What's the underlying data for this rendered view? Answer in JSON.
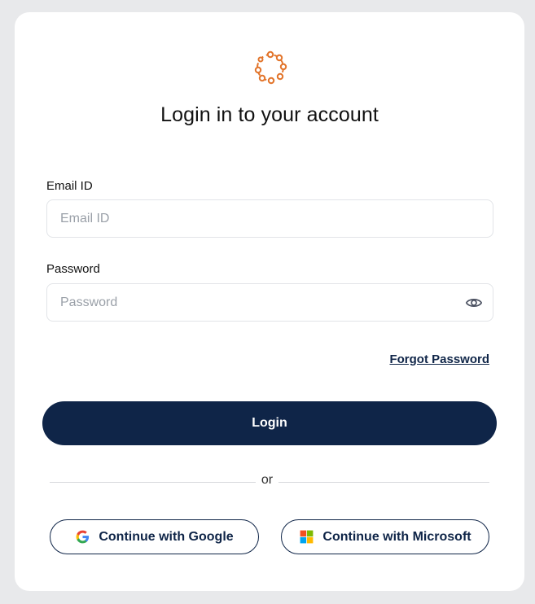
{
  "page": {
    "title": "Login in to your account",
    "brand_color": "#e2742a",
    "accent_color": "#0f2548"
  },
  "logo": {
    "icon": "ring-logo-icon"
  },
  "form": {
    "email": {
      "label": "Email ID",
      "placeholder": "Email ID",
      "value": ""
    },
    "password": {
      "label": "Password",
      "placeholder": "Password",
      "value": "",
      "toggle_icon": "eye-icon"
    },
    "forgot_label": "Forgot Password",
    "login_label": "Login"
  },
  "divider": {
    "text": "or"
  },
  "sso": {
    "google": {
      "label": "Continue with Google",
      "icon": "google-icon"
    },
    "microsoft": {
      "label": "Continue with Microsoft",
      "icon": "microsoft-icon"
    }
  }
}
